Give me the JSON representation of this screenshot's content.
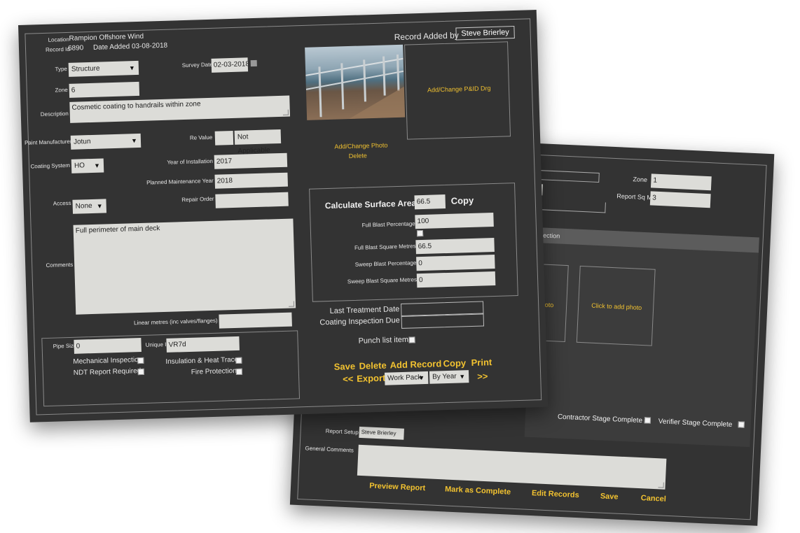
{
  "record": {
    "location_label": "Location",
    "location_value": "Rampion Offshore Wind",
    "record_id_label": "Record Id",
    "record_id_value": "6890",
    "date_added": "Date Added 03-08-2018",
    "record_added_by_label": "Record Added by",
    "record_added_by_value": "Steve Brierley"
  },
  "form": {
    "type_label": "Type",
    "type_value": "Structure",
    "survey_date_label": "Survey Date",
    "survey_date_value": "02-03-2018",
    "zone_label": "Zone",
    "zone_value": "6",
    "description_label": "Description",
    "description_value": "Cosmetic coating to handrails within zone",
    "paint_manufacturer_label": "Paint Manufacturer",
    "paint_manufacturer_value": "Jotun",
    "re_value_label": "Re Value",
    "re_value_value": "",
    "re_value_select": "Not Applicable",
    "coating_system_label": "Coating System",
    "coating_system_value": "HO",
    "year_installation_label": "Year of Installation",
    "year_installation_value": "2017",
    "planned_maintenance_label": "Planned Maintenance Year",
    "planned_maintenance_value": "2018",
    "access_label": "Access",
    "access_value": "None",
    "repair_order_label": "Repair Order",
    "repair_order_value": "",
    "comments_label": "Comments",
    "comments_value": "Full perimeter of main deck",
    "linear_metres_label": "Linear metres (inc valves/flanges)",
    "linear_metres_value": "",
    "pipe_size_label": "Pipe Size",
    "pipe_size_value": "0",
    "unique_id_label": "Unique ID",
    "unique_id_value": "VR7d",
    "mechanical_inspection_label": "Mechanical Inspection",
    "ndt_report_label": "NDT Report Required",
    "insulation_label": "Insulation & Heat Trace",
    "fire_protection_label": "Fire Protection"
  },
  "media": {
    "add_change_pid": "Add/Change P&ID Drg",
    "add_change_photo": "Add/Change Photo",
    "delete_photo": "Delete"
  },
  "surface": {
    "calculate_label": "Calculate Surface Area",
    "calculate_value": "66.5",
    "copy_label": "Copy",
    "full_blast_pct_label": "Full Blast Percentage",
    "full_blast_pct_value": "100",
    "full_blast_sqm_label": "Full Blast Square Metres",
    "full_blast_sqm_value": "66.5",
    "sweep_blast_pct_label": "Sweep Blast Percentage",
    "sweep_blast_pct_value": "0",
    "sweep_blast_sqm_label": "Sweep Blast Square Metres",
    "sweep_blast_sqm_value": "0"
  },
  "treatment": {
    "last_treatment_label": "Last Treatment Date",
    "coating_due_label": "Coating Inspection Due",
    "punch_list_label": "Punch list item"
  },
  "actions": {
    "save": "Save",
    "delete": "Delete",
    "add_record": "Add Record",
    "copy": "Copy",
    "print": "Print",
    "prev": "<<",
    "export": "Export",
    "work_pack": "Work Pack",
    "by_year": "By Year",
    "next": ">>"
  },
  "back_panel": {
    "zone_label": "Zone",
    "zone_value": "1",
    "report_sqm_label": "Report Sq M",
    "report_sqm_value": "3",
    "inspection_header": "spection",
    "photo_partial": "d photo",
    "click_to_add_photo": "Click to add photo",
    "contractor_stage": "Contractor Stage Complete",
    "verifier_stage": "Verifier Stage Complete",
    "report_setup_label": "Report Setup",
    "report_setup_value": "Steve Brierley",
    "general_comments_label": "General Comments",
    "preview_report": "Preview Report",
    "mark_complete": "Mark as Complete",
    "edit_records": "Edit Records",
    "save": "Save",
    "cancel": "Cancel"
  },
  "colors": {
    "panel_bg": "#333333",
    "field_bg": "#dcdcd8",
    "accent_yellow": "#f2c230"
  }
}
